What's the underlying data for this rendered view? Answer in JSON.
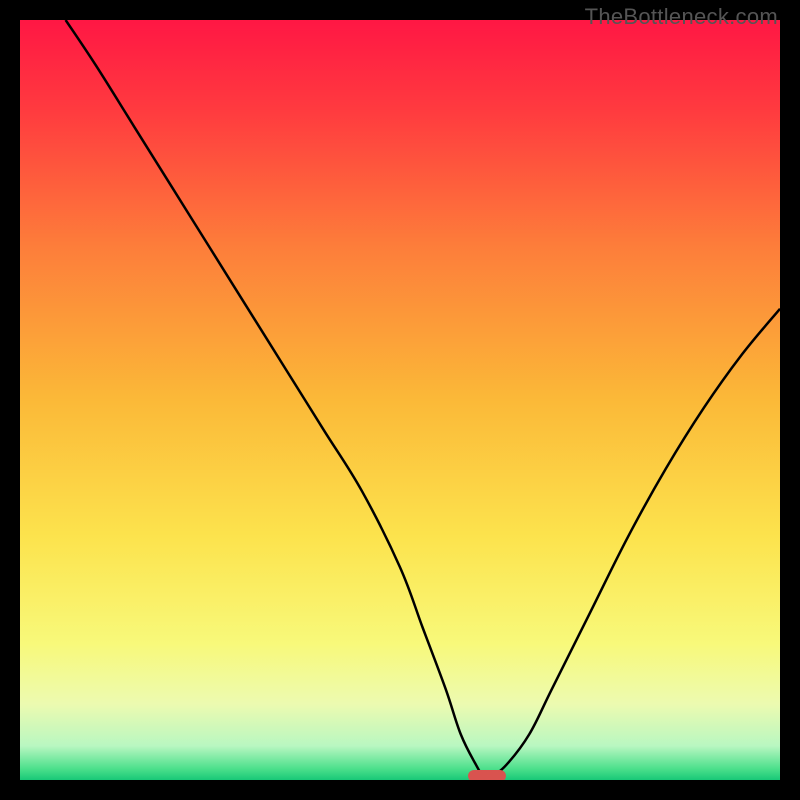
{
  "watermark": "TheBottleneck.com",
  "chart_data": {
    "type": "line",
    "title": "",
    "xlabel": "",
    "ylabel": "",
    "xlim": [
      0,
      100
    ],
    "ylim": [
      0,
      100
    ],
    "grid": false,
    "legend": false,
    "series": [
      {
        "name": "bottleneck-curve",
        "x": [
          6,
          10,
          15,
          20,
          25,
          30,
          35,
          40,
          45,
          50,
          53,
          56,
          58,
          60,
          61,
          62,
          64,
          67,
          70,
          75,
          80,
          85,
          90,
          95,
          100
        ],
        "y": [
          100,
          94,
          86,
          78,
          70,
          62,
          54,
          46,
          38,
          28,
          20,
          12,
          6,
          2,
          0.5,
          0.5,
          2,
          6,
          12,
          22,
          32,
          41,
          49,
          56,
          62
        ]
      },
      {
        "name": "optimal-marker",
        "x": [
          59,
          64
        ],
        "y": [
          0.5,
          0.5
        ]
      }
    ],
    "colors": {
      "curve": "#000000",
      "marker": "#d9534f",
      "gradient_stops": [
        {
          "offset": 0.0,
          "color": "#ff1744"
        },
        {
          "offset": 0.12,
          "color": "#ff3b3f"
        },
        {
          "offset": 0.3,
          "color": "#fd7e3a"
        },
        {
          "offset": 0.5,
          "color": "#fbb938"
        },
        {
          "offset": 0.68,
          "color": "#fce34d"
        },
        {
          "offset": 0.82,
          "color": "#f8f97a"
        },
        {
          "offset": 0.9,
          "color": "#ecfab0"
        },
        {
          "offset": 0.955,
          "color": "#b9f7c1"
        },
        {
          "offset": 0.985,
          "color": "#4de08c"
        },
        {
          "offset": 1.0,
          "color": "#18c877"
        }
      ]
    }
  }
}
